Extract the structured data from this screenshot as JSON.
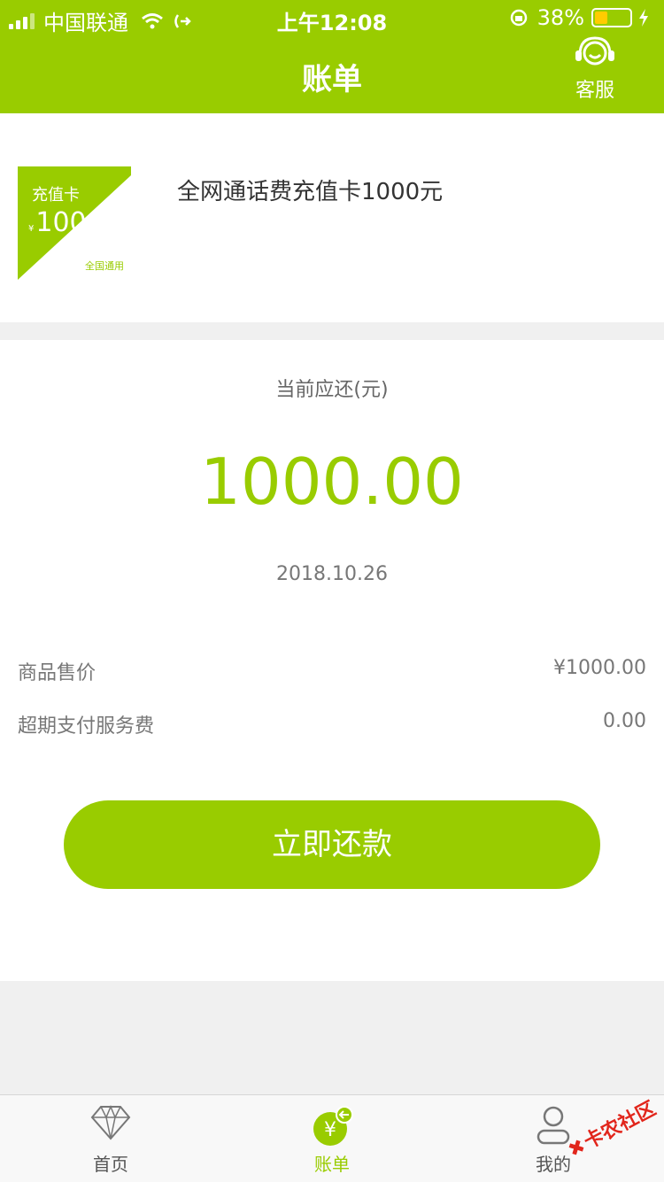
{
  "status_bar": {
    "carrier": "中国联通",
    "time": "上午12:08",
    "battery": "38%",
    "battery_level": 0.38
  },
  "header": {
    "title": "账单",
    "customer_service_label": "客服"
  },
  "product": {
    "card_title": "充值卡",
    "card_currency": "¥",
    "card_amount": "1000",
    "card_scope": "全国通用",
    "name": "全网通话费充值卡1000元"
  },
  "bill": {
    "due_label": "当前应还(元)",
    "amount": "1000.00",
    "date": "2018.10.26",
    "rows": [
      {
        "label": "商品售价",
        "value": "¥1000.00"
      },
      {
        "label": "超期支付服务费",
        "value": "0.00"
      }
    ],
    "pay_button": "立即还款"
  },
  "tabbar": {
    "tabs": [
      {
        "label": "首页",
        "icon": "diamond-icon"
      },
      {
        "label": "账单",
        "icon": "yuan-bill-icon",
        "active": true
      },
      {
        "label": "我的",
        "icon": "user-icon"
      }
    ]
  },
  "watermark": {
    "text": "卡农社区"
  },
  "colors": {
    "accent": "#99cc00",
    "background": "#f0f0f0"
  }
}
